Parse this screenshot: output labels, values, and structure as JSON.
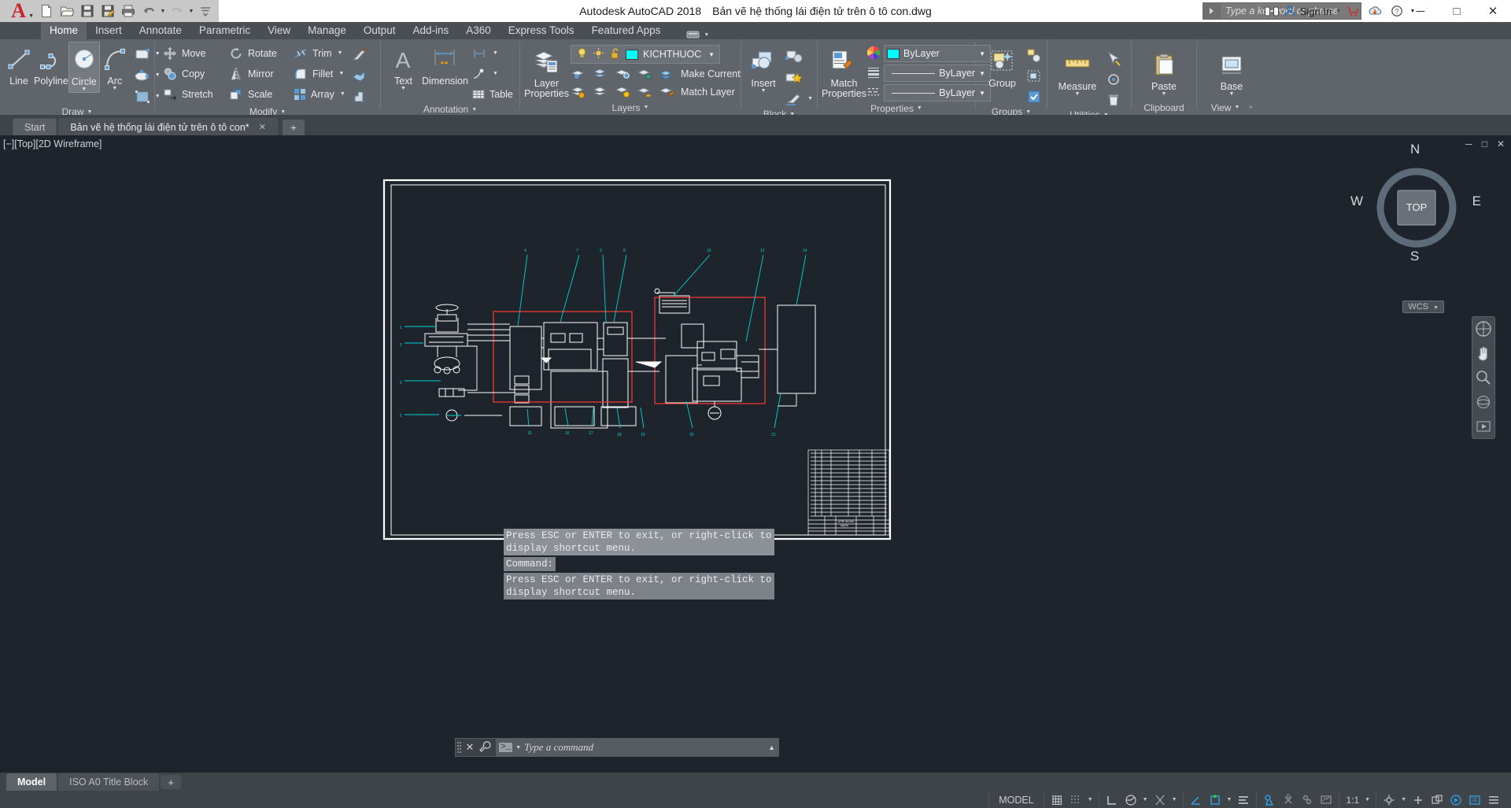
{
  "titlebar": {
    "app_name": "Autodesk AutoCAD 2018",
    "document_name": "Bản vẽ hệ thống lái điện tử trên ô tô con.dwg",
    "search_placeholder": "Type a keyword or phrase",
    "sign_in": "Sign In",
    "quick_access": [
      {
        "name": "new-file",
        "label": "New"
      },
      {
        "name": "open-file",
        "label": "Open"
      },
      {
        "name": "save-file",
        "label": "Save"
      },
      {
        "name": "save-as-file",
        "label": "Save As"
      },
      {
        "name": "plot",
        "label": "Plot"
      },
      {
        "name": "undo",
        "label": "Undo"
      },
      {
        "name": "redo",
        "label": "Redo"
      },
      {
        "name": "customize-qat",
        "label": "Customize"
      }
    ],
    "window_buttons": {
      "minimize": "─",
      "maximize": "□",
      "close": "✕"
    }
  },
  "ribbon": {
    "tabs": [
      "Home",
      "Insert",
      "Annotate",
      "Parametric",
      "View",
      "Manage",
      "Output",
      "Add-ins",
      "A360",
      "Express Tools",
      "Featured Apps"
    ],
    "active_tab": "Home",
    "panels": {
      "draw": {
        "title": "Draw",
        "line": "Line",
        "polyline": "Polyline",
        "circle": "Circle",
        "arc": "Arc"
      },
      "modify": {
        "title": "Modify",
        "move": "Move",
        "rotate": "Rotate",
        "trim": "Trim",
        "copy": "Copy",
        "mirror": "Mirror",
        "fillet": "Fillet",
        "stretch": "Stretch",
        "scale": "Scale",
        "array": "Array"
      },
      "annotation": {
        "title": "Annotation",
        "text": "Text",
        "dimension": "Dimension",
        "table": "Table"
      },
      "layers": {
        "title": "Layers",
        "layer_properties": "Layer\nProperties",
        "current_layer": "KICHTHUOC",
        "layer_color": "#00ffff",
        "make_current": "Make Current",
        "match_layer": "Match Layer"
      },
      "block": {
        "title": "Block",
        "insert": "Insert"
      },
      "properties": {
        "title": "Properties",
        "match_properties": "Match\nProperties",
        "color": "ByLayer",
        "color_swatch": "#00ffff",
        "linewidth": "ByLayer",
        "linetype": "ByLayer"
      },
      "groups": {
        "title": "Groups",
        "group": "Group"
      },
      "utilities": {
        "title": "Utilities",
        "measure": "Measure"
      },
      "clipboard": {
        "title": "Clipboard",
        "paste": "Paste"
      },
      "view": {
        "title": "View",
        "base": "Base"
      }
    }
  },
  "file_tabs": {
    "tabs": [
      {
        "label": "Start",
        "active": false,
        "closeable": false
      },
      {
        "label": "Bản vẽ hệ thống lái điện tử trên ô tô con*",
        "active": true,
        "closeable": true
      }
    ],
    "new_tab": "+"
  },
  "viewport": {
    "control_label": "[−][Top][2D Wireframe]",
    "minimize": "─",
    "maximize": "□",
    "close": "✕",
    "viewcube": {
      "top": "TOP",
      "north": "N",
      "south": "S",
      "east": "E",
      "west": "W"
    },
    "wcs_label": "WCS",
    "nav_tools": [
      "steering-wheel",
      "pan",
      "zoom-extents",
      "orbit",
      "show-motion"
    ]
  },
  "command_history": [
    "Press ESC or ENTER to exit, or right-click to\ndisplay shortcut menu.",
    "Command:",
    "Press ESC or ENTER to exit, or right-click to\ndisplay shortcut menu."
  ],
  "command_bar": {
    "placeholder": "Type a command",
    "prompt_symbol": ">_",
    "close": "✕"
  },
  "layout_tabs": {
    "tabs": [
      {
        "label": "Model",
        "active": true
      },
      {
        "label": "ISO A0 Title Block",
        "active": false
      }
    ],
    "new_layout": "+"
  },
  "status_bar": {
    "space": "MODEL",
    "scale": "1:1",
    "items": [
      {
        "name": "grid-display",
        "label": "grid"
      },
      {
        "name": "snap-mode",
        "label": "snap"
      },
      {
        "name": "ortho-mode",
        "label": "ortho"
      },
      {
        "name": "polar-tracking",
        "label": "polar"
      },
      {
        "name": "object-snap",
        "label": "osnap"
      },
      {
        "name": "object-snap-tracking",
        "label": "otrack"
      },
      {
        "name": "dynamic-ucs",
        "label": "ducs"
      },
      {
        "name": "dynamic-input",
        "label": "dyn"
      },
      {
        "name": "lineweight",
        "label": "lwt"
      },
      {
        "name": "transparency",
        "label": "transparency"
      },
      {
        "name": "selection-cycling",
        "label": "selection-cycling"
      },
      {
        "name": "annotation-monitor",
        "label": "annotation"
      },
      {
        "name": "annotation-scale",
        "label": "1:1"
      },
      {
        "name": "workspace-switching",
        "label": "workspace"
      },
      {
        "name": "annotation-visibility",
        "label": "annotation-visibility"
      },
      {
        "name": "hardware-acceleration",
        "label": "hardware"
      },
      {
        "name": "isolate-objects",
        "label": "isolate"
      },
      {
        "name": "clean-screen",
        "label": "clean-screen"
      },
      {
        "name": "customization",
        "label": "customize"
      }
    ]
  }
}
